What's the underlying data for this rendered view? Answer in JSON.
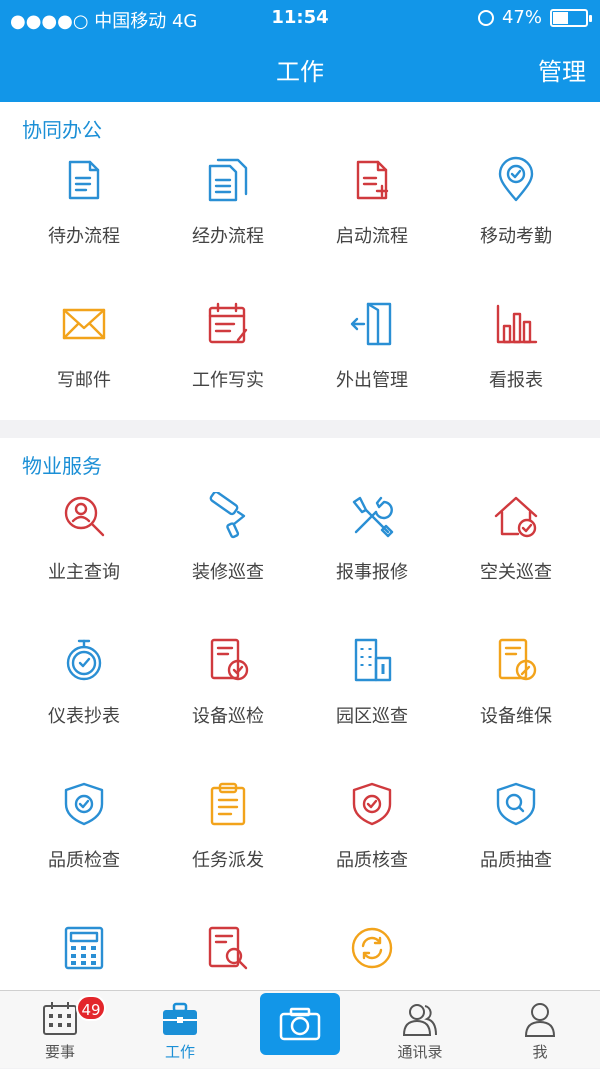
{
  "status_bar": {
    "carrier": "●●●●○ 中国移动  4G",
    "time": "11:54",
    "battery": "47%",
    "battery_level": 0.47
  },
  "nav": {
    "title": "工作",
    "right_action": "管理"
  },
  "section_office": {
    "title": "协同办公",
    "items": [
      {
        "label": "待办流程",
        "icon": "pending-document-icon",
        "color": "#2a8fd4"
      },
      {
        "label": "经办流程",
        "icon": "documents-icon",
        "color": "#2a8fd4"
      },
      {
        "label": "启动流程",
        "icon": "new-document-icon",
        "color": "#d03a3e"
      },
      {
        "label": "移动考勤",
        "icon": "location-check-icon",
        "color": "#2a8fd4"
      },
      {
        "label": "写邮件",
        "icon": "mail-icon",
        "color": "#f2a31b"
      },
      {
        "label": "工作写实",
        "icon": "calendar-edit-icon",
        "color": "#d03a3e"
      },
      {
        "label": "外出管理",
        "icon": "door-exit-icon",
        "color": "#2a8fd4"
      },
      {
        "label": "看报表",
        "icon": "bar-chart-icon",
        "color": "#d03a3e"
      }
    ]
  },
  "section_property": {
    "title": "物业服务",
    "items": [
      {
        "label": "业主查询",
        "icon": "user-search-icon",
        "color": "#d03a3e"
      },
      {
        "label": "装修巡查",
        "icon": "paint-roller-icon",
        "color": "#2a8fd4"
      },
      {
        "label": "报事报修",
        "icon": "tools-icon",
        "color": "#2a8fd4"
      },
      {
        "label": "空关巡查",
        "icon": "house-check-icon",
        "color": "#d03a3e"
      },
      {
        "label": "仪表抄表",
        "icon": "stopwatch-icon",
        "color": "#2a8fd4"
      },
      {
        "label": "设备巡检",
        "icon": "device-check-icon",
        "color": "#d03a3e"
      },
      {
        "label": "园区巡查",
        "icon": "building-icon",
        "color": "#2a8fd4"
      },
      {
        "label": "设备维保",
        "icon": "device-wrench-icon",
        "color": "#f2a31b"
      },
      {
        "label": "品质检查",
        "icon": "shield-check-icon",
        "color": "#2a8fd4"
      },
      {
        "label": "任务派发",
        "icon": "clipboard-icon",
        "color": "#f2a31b"
      },
      {
        "label": "品质核查",
        "icon": "shield-check-red-icon",
        "color": "#d03a3e"
      },
      {
        "label": "品质抽查",
        "icon": "shield-search-icon",
        "color": "#2a8fd4"
      },
      {
        "label": "",
        "icon": "calculator-icon",
        "color": "#2a8fd4"
      },
      {
        "label": "",
        "icon": "document-search-icon",
        "color": "#d03a3e"
      },
      {
        "label": "",
        "icon": "sync-icon",
        "color": "#f2a31b"
      }
    ]
  },
  "tabbar": {
    "items": [
      {
        "label": "要事",
        "icon": "calendar-grid-icon",
        "badge": "49"
      },
      {
        "label": "工作",
        "icon": "briefcase-icon"
      },
      {
        "label": "",
        "icon": "camera-icon"
      },
      {
        "label": "通讯录",
        "icon": "contacts-icon"
      },
      {
        "label": "我",
        "icon": "person-icon"
      }
    ]
  }
}
